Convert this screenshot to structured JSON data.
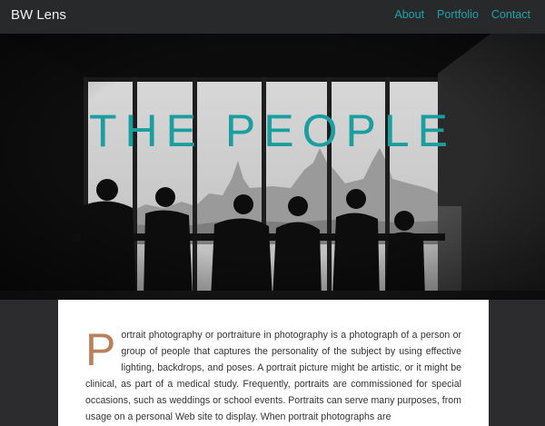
{
  "navbar": {
    "brand": "BW Lens",
    "links": [
      {
        "label": "About"
      },
      {
        "label": "Portfolio"
      },
      {
        "label": "Contact"
      }
    ]
  },
  "hero": {
    "title": "THE PEOPLE",
    "image_alt": "black and white photo of people sitting at a window bar overlooking a city"
  },
  "article": {
    "dropcap": "P",
    "body": "ortrait photography or portraiture in photography is a photograph of a person or group of people that captures the personality of the subject by using effective lighting, backdrops, and poses. A portrait picture might be artistic, or it might be clinical, as part of a medical study. Frequently, portraits are commissioned for special occasions, such as weddings or school events. Portraits can serve many purposes, from usage on a personal Web site to display. When portrait photographs are"
  },
  "colors": {
    "accent": "#1fa3a8",
    "dropcap": "#b9825d",
    "navbar_bg": "#28292b",
    "page_bg": "#2c2c2e"
  }
}
